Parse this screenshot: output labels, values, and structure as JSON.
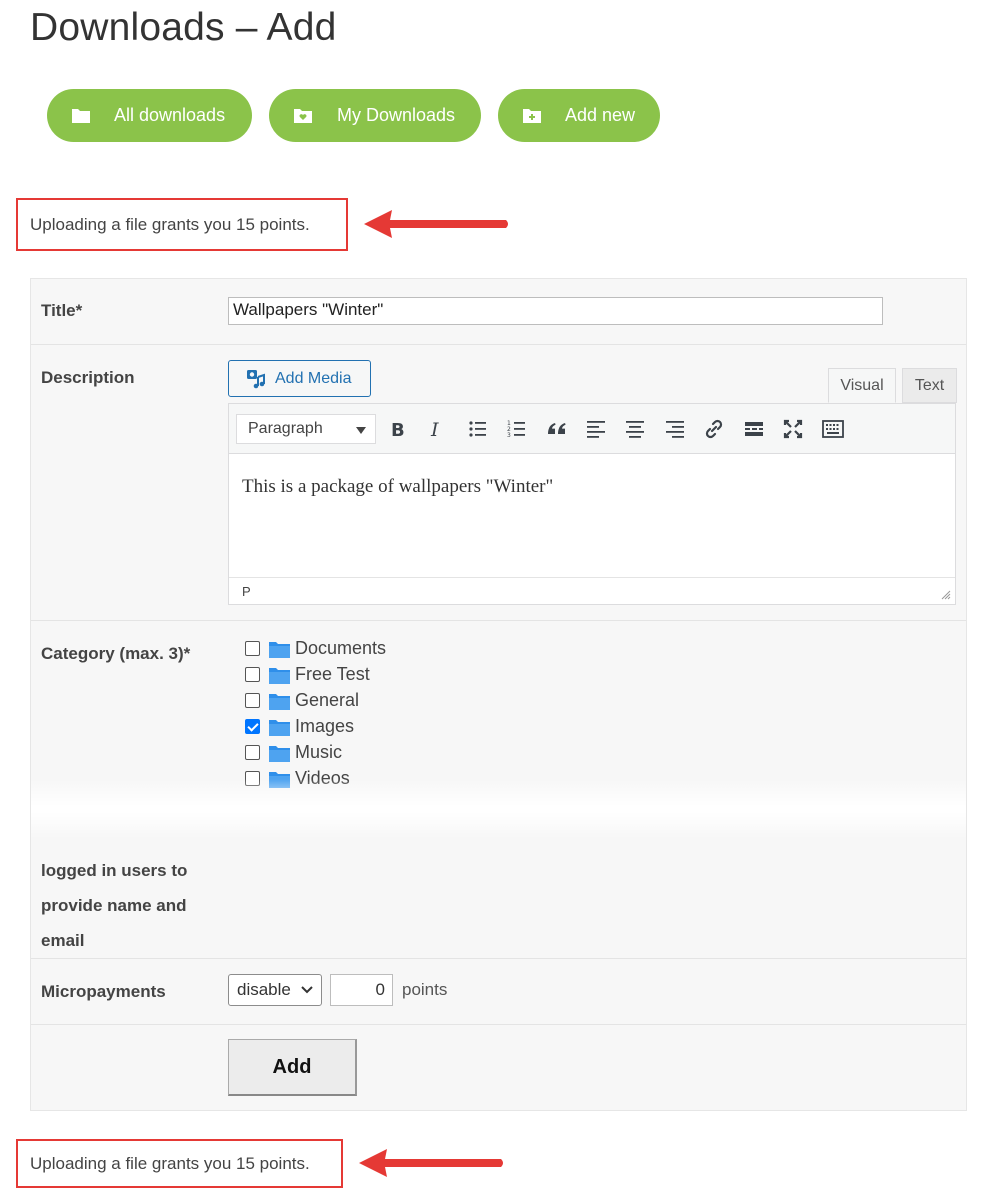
{
  "page": {
    "title": "Downloads – Add"
  },
  "nav": {
    "all_downloads": {
      "label": "All downloads",
      "icon": "folder-icon"
    },
    "my_downloads": {
      "label": "My Downloads",
      "icon": "folder-heart-icon"
    },
    "add_new": {
      "label": "Add new",
      "icon": "folder-plus-icon"
    }
  },
  "notices": {
    "top": "Uploading a file grants you 15 points.",
    "bottom": "Uploading a file grants you 15 points."
  },
  "form": {
    "title": {
      "label": "Title*",
      "value": "Wallpapers \"Winter\""
    },
    "description": {
      "label": "Description",
      "add_media_label": "Add Media",
      "tabs": {
        "visual": "Visual",
        "text": "Text"
      },
      "format_select": "Paragraph",
      "toolbar_icons": [
        "bold-icon",
        "italic-icon",
        "bullet-list-icon",
        "numbered-list-icon",
        "blockquote-icon",
        "align-left-icon",
        "align-center-icon",
        "align-right-icon",
        "link-icon",
        "read-more-icon",
        "fullscreen-icon",
        "toolbar-toggle-icon"
      ],
      "content": "This is a package of wallpapers \"Winter\"",
      "status_path": "P"
    },
    "category": {
      "label": "Category (max. 3)*",
      "items": [
        {
          "name": "Documents",
          "checked": false
        },
        {
          "name": "Free Test",
          "checked": false
        },
        {
          "name": "General",
          "checked": false
        },
        {
          "name": "Images",
          "checked": true
        },
        {
          "name": "Music",
          "checked": false
        },
        {
          "name": "Videos",
          "checked": false
        }
      ]
    },
    "logged_in": {
      "label_lines": [
        "logged in users to",
        "provide name and",
        "email"
      ]
    },
    "micropayments": {
      "label": "Micropayments",
      "select_value": "disable",
      "points_value": "0",
      "points_label": "points"
    },
    "submit_label": "Add"
  },
  "colors": {
    "nav_button": "#8bc34a",
    "highlight_border": "#e53935",
    "arrow": "#e53935",
    "link_blue": "#2271b1",
    "folder_blue": "#2f8fea",
    "checkbox_checked": "#0075ff"
  }
}
